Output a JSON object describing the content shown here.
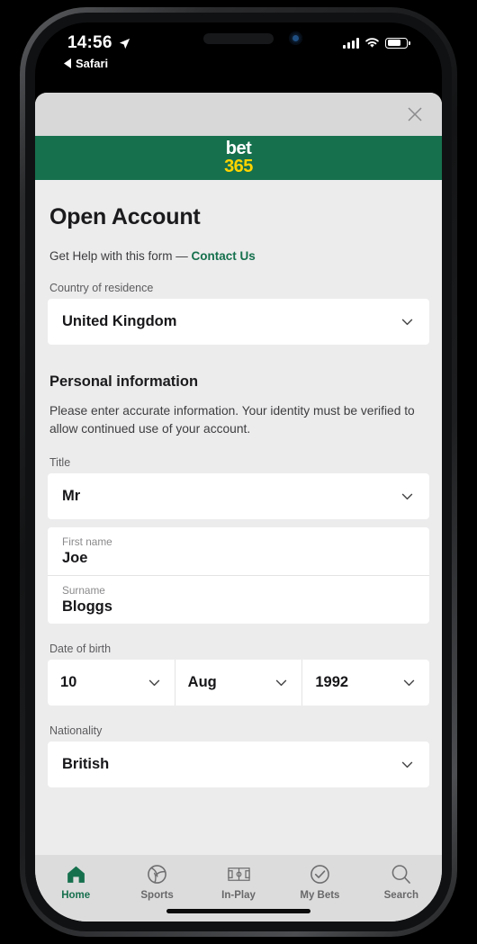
{
  "status_bar": {
    "time": "14:56",
    "location_icon": "location-arrow-icon",
    "back_label": "Safari",
    "back_icon": "triangle-left-icon",
    "signal_icon": "cellular-bars-icon",
    "wifi_icon": "wifi-icon",
    "battery_icon": "battery-icon"
  },
  "sheet": {
    "close_icon": "close-icon",
    "brand": {
      "line1": "bet",
      "line2": "365",
      "color_green": "#16704e",
      "color_yellow": "#ffd400"
    }
  },
  "form": {
    "title": "Open Account",
    "help_text": "Get Help with this form — ",
    "help_link": "Contact Us",
    "country": {
      "label": "Country of residence",
      "value": "United Kingdom",
      "chevron_icon": "chevron-down-icon"
    },
    "personal": {
      "heading": "Personal information",
      "description": "Please enter accurate information. Your identity must be verified to allow continued use of your account."
    },
    "title_field": {
      "label": "Title",
      "value": "Mr",
      "chevron_icon": "chevron-down-icon"
    },
    "first_name": {
      "label": "First name",
      "value": "Joe"
    },
    "surname": {
      "label": "Surname",
      "value": "Bloggs"
    },
    "dob": {
      "label": "Date of birth",
      "day": "10",
      "month": "Aug",
      "year": "1992",
      "chevron_icon": "chevron-down-icon"
    },
    "nationality": {
      "label": "Nationality",
      "value": "British",
      "chevron_icon": "chevron-down-icon"
    }
  },
  "tabbar": {
    "items": [
      {
        "label": "Home",
        "icon": "home-icon",
        "active": true
      },
      {
        "label": "Sports",
        "icon": "ball-icon",
        "active": false
      },
      {
        "label": "In-Play",
        "icon": "pitch-icon",
        "active": false
      },
      {
        "label": "My Bets",
        "icon": "check-circle-icon",
        "active": false
      },
      {
        "label": "Search",
        "icon": "search-icon",
        "active": false
      }
    ],
    "active_color": "#16704e",
    "inactive_color": "#68686a"
  }
}
